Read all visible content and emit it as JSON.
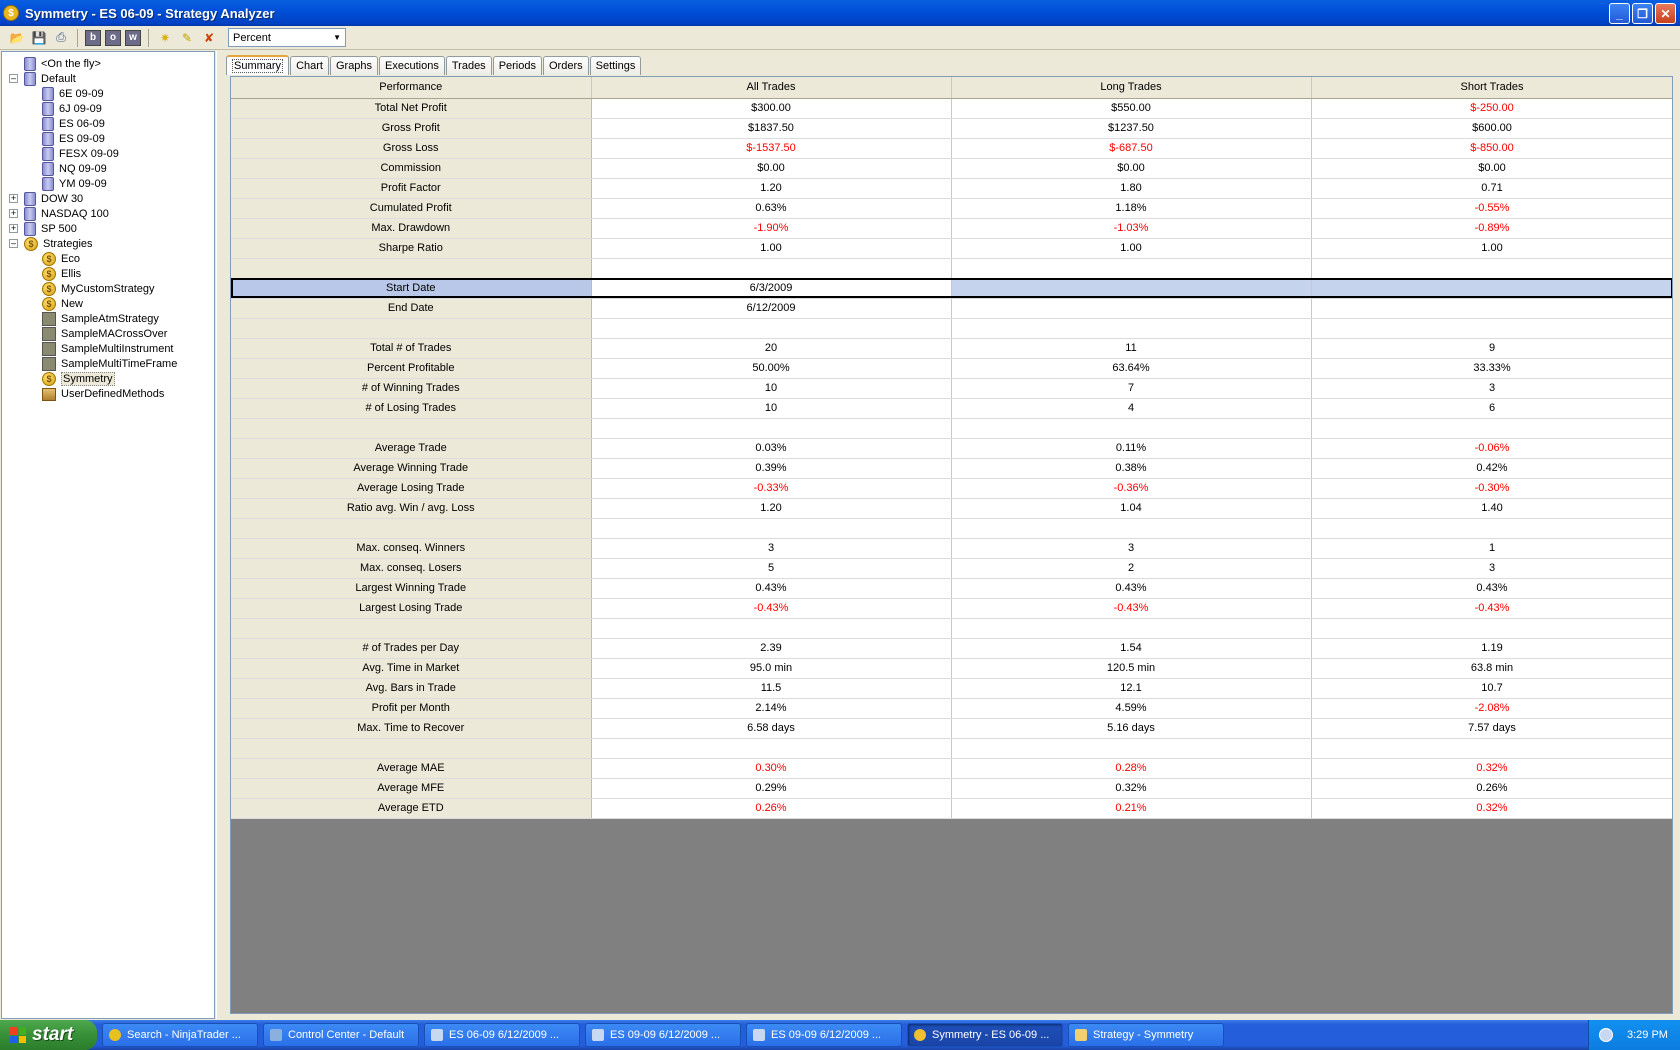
{
  "window": {
    "title": "Symmetry - ES 06-09 - Strategy Analyzer"
  },
  "toolbar": {
    "view_mode": "Percent",
    "icons": [
      "open-icon",
      "save-icon",
      "print-icon",
      "b-icon",
      "o-icon",
      "w-icon",
      "sun-icon",
      "wand-icon",
      "delete-icon"
    ]
  },
  "tree": [
    {
      "label": "<On the fly>",
      "icon": "db",
      "level": 1
    },
    {
      "label": "Default",
      "icon": "db",
      "level": 0,
      "expander": "−"
    },
    {
      "label": "6E 09-09",
      "icon": "db",
      "level": 2
    },
    {
      "label": "6J 09-09",
      "icon": "db",
      "level": 2
    },
    {
      "label": "ES 06-09",
      "icon": "db",
      "level": 2
    },
    {
      "label": "ES 09-09",
      "icon": "db",
      "level": 2
    },
    {
      "label": "FESX 09-09",
      "icon": "db",
      "level": 2
    },
    {
      "label": "NQ 09-09",
      "icon": "db",
      "level": 2
    },
    {
      "label": "YM 09-09",
      "icon": "db",
      "level": 2
    },
    {
      "label": "DOW 30",
      "icon": "db",
      "level": 0,
      "expander": "+"
    },
    {
      "label": "NASDAQ 100",
      "icon": "db",
      "level": 0,
      "expander": "+"
    },
    {
      "label": "SP 500",
      "icon": "db",
      "level": 0,
      "expander": "+"
    },
    {
      "label": "Strategies",
      "icon": "coin",
      "level": 0,
      "expander": "−"
    },
    {
      "label": "Eco",
      "icon": "coin",
      "level": 2
    },
    {
      "label": "Ellis",
      "icon": "coin",
      "level": 2
    },
    {
      "label": "MyCustomStrategy",
      "icon": "coin",
      "level": 2
    },
    {
      "label": "New",
      "icon": "coin",
      "level": 2
    },
    {
      "label": "SampleAtmStrategy",
      "icon": "gear",
      "level": 2
    },
    {
      "label": "SampleMACrossOver",
      "icon": "gear",
      "level": 2
    },
    {
      "label": "SampleMultiInstrument",
      "icon": "gear",
      "level": 2
    },
    {
      "label": "SampleMultiTimeFrame",
      "icon": "gear",
      "level": 2
    },
    {
      "label": "Symmetry",
      "icon": "coin",
      "level": 2,
      "selected": true
    },
    {
      "label": "UserDefinedMethods",
      "icon": "box",
      "level": 2
    }
  ],
  "tabs": [
    "Summary",
    "Chart",
    "Graphs",
    "Executions",
    "Trades",
    "Periods",
    "Orders",
    "Settings"
  ],
  "grid": {
    "headers": [
      "Performance",
      "All Trades",
      "Long Trades",
      "Short Trades"
    ],
    "rows": [
      [
        "Total Net Profit",
        "$300.00",
        "$550.00",
        "$-250.00"
      ],
      [
        "Gross Profit",
        "$1837.50",
        "$1237.50",
        "$600.00"
      ],
      [
        "Gross Loss",
        "$-1537.50",
        "$-687.50",
        "$-850.00"
      ],
      [
        "Commission",
        "$0.00",
        "$0.00",
        "$0.00"
      ],
      [
        "Profit Factor",
        "1.20",
        "1.80",
        "0.71"
      ],
      [
        "Cumulated Profit",
        "0.63%",
        "1.18%",
        "-0.55%"
      ],
      [
        "Max. Drawdown",
        "-1.90%",
        "-1.03%",
        "-0.89%"
      ],
      [
        "Sharpe Ratio",
        "1.00",
        "1.00",
        "1.00"
      ],
      [
        "",
        "",
        "",
        ""
      ],
      [
        "Start Date",
        "6/3/2009",
        "",
        ""
      ],
      [
        "End Date",
        "6/12/2009",
        "",
        ""
      ],
      [
        "",
        "",
        "",
        ""
      ],
      [
        "Total # of Trades",
        "20",
        "11",
        "9"
      ],
      [
        "Percent Profitable",
        "50.00%",
        "63.64%",
        "33.33%"
      ],
      [
        "# of Winning Trades",
        "10",
        "7",
        "3"
      ],
      [
        "# of Losing Trades",
        "10",
        "4",
        "6"
      ],
      [
        "",
        "",
        "",
        ""
      ],
      [
        "Average Trade",
        "0.03%",
        "0.11%",
        "-0.06%"
      ],
      [
        "Average Winning Trade",
        "0.39%",
        "0.38%",
        "0.42%"
      ],
      [
        "Average Losing Trade",
        "-0.33%",
        "-0.36%",
        "-0.30%"
      ],
      [
        "Ratio avg. Win / avg. Loss",
        "1.20",
        "1.04",
        "1.40"
      ],
      [
        "",
        "",
        "",
        ""
      ],
      [
        "Max. conseq. Winners",
        "3",
        "3",
        "1"
      ],
      [
        "Max. conseq. Losers",
        "5",
        "2",
        "3"
      ],
      [
        "Largest Winning Trade",
        "0.43%",
        "0.43%",
        "0.43%"
      ],
      [
        "Largest Losing Trade",
        "-0.43%",
        "-0.43%",
        "-0.43%"
      ],
      [
        "",
        "",
        "",
        ""
      ],
      [
        "# of Trades per Day",
        "2.39",
        "1.54",
        "1.19"
      ],
      [
        "Avg. Time in Market",
        "95.0 min",
        "120.5 min",
        "63.8 min"
      ],
      [
        "Avg. Bars in Trade",
        "11.5",
        "12.1",
        "10.7"
      ],
      [
        "Profit per Month",
        "2.14%",
        "4.59%",
        "-2.08%"
      ],
      [
        "Max. Time to Recover",
        "6.58 days",
        "5.16 days",
        "7.57 days"
      ],
      [
        "",
        "",
        "",
        ""
      ],
      [
        "Average MAE",
        "0.30%",
        "0.28%",
        "0.32%"
      ],
      [
        "Average MFE",
        "0.29%",
        "0.32%",
        "0.26%"
      ],
      [
        "Average ETD",
        "0.26%",
        "0.21%",
        "0.32%"
      ]
    ],
    "selected_row": "Start Date",
    "negative_color": "#ff0000"
  },
  "taskbar": {
    "start_label": "start",
    "tasks": [
      {
        "label": "Search - NinjaTrader ...",
        "icon": "chrome"
      },
      {
        "label": "Control Center - Default",
        "icon": "ninja"
      },
      {
        "label": "ES 06-09  6/12/2009 ...",
        "icon": "chart"
      },
      {
        "label": "ES 09-09  6/12/2009 ...",
        "icon": "chart"
      },
      {
        "label": "ES 09-09  6/12/2009 ...",
        "icon": "chart"
      },
      {
        "label": "Symmetry - ES 06-09 ...",
        "icon": "coin",
        "active": true
      },
      {
        "label": "Strategy - Symmetry",
        "icon": "folder"
      }
    ],
    "clock": "3:29 PM"
  }
}
